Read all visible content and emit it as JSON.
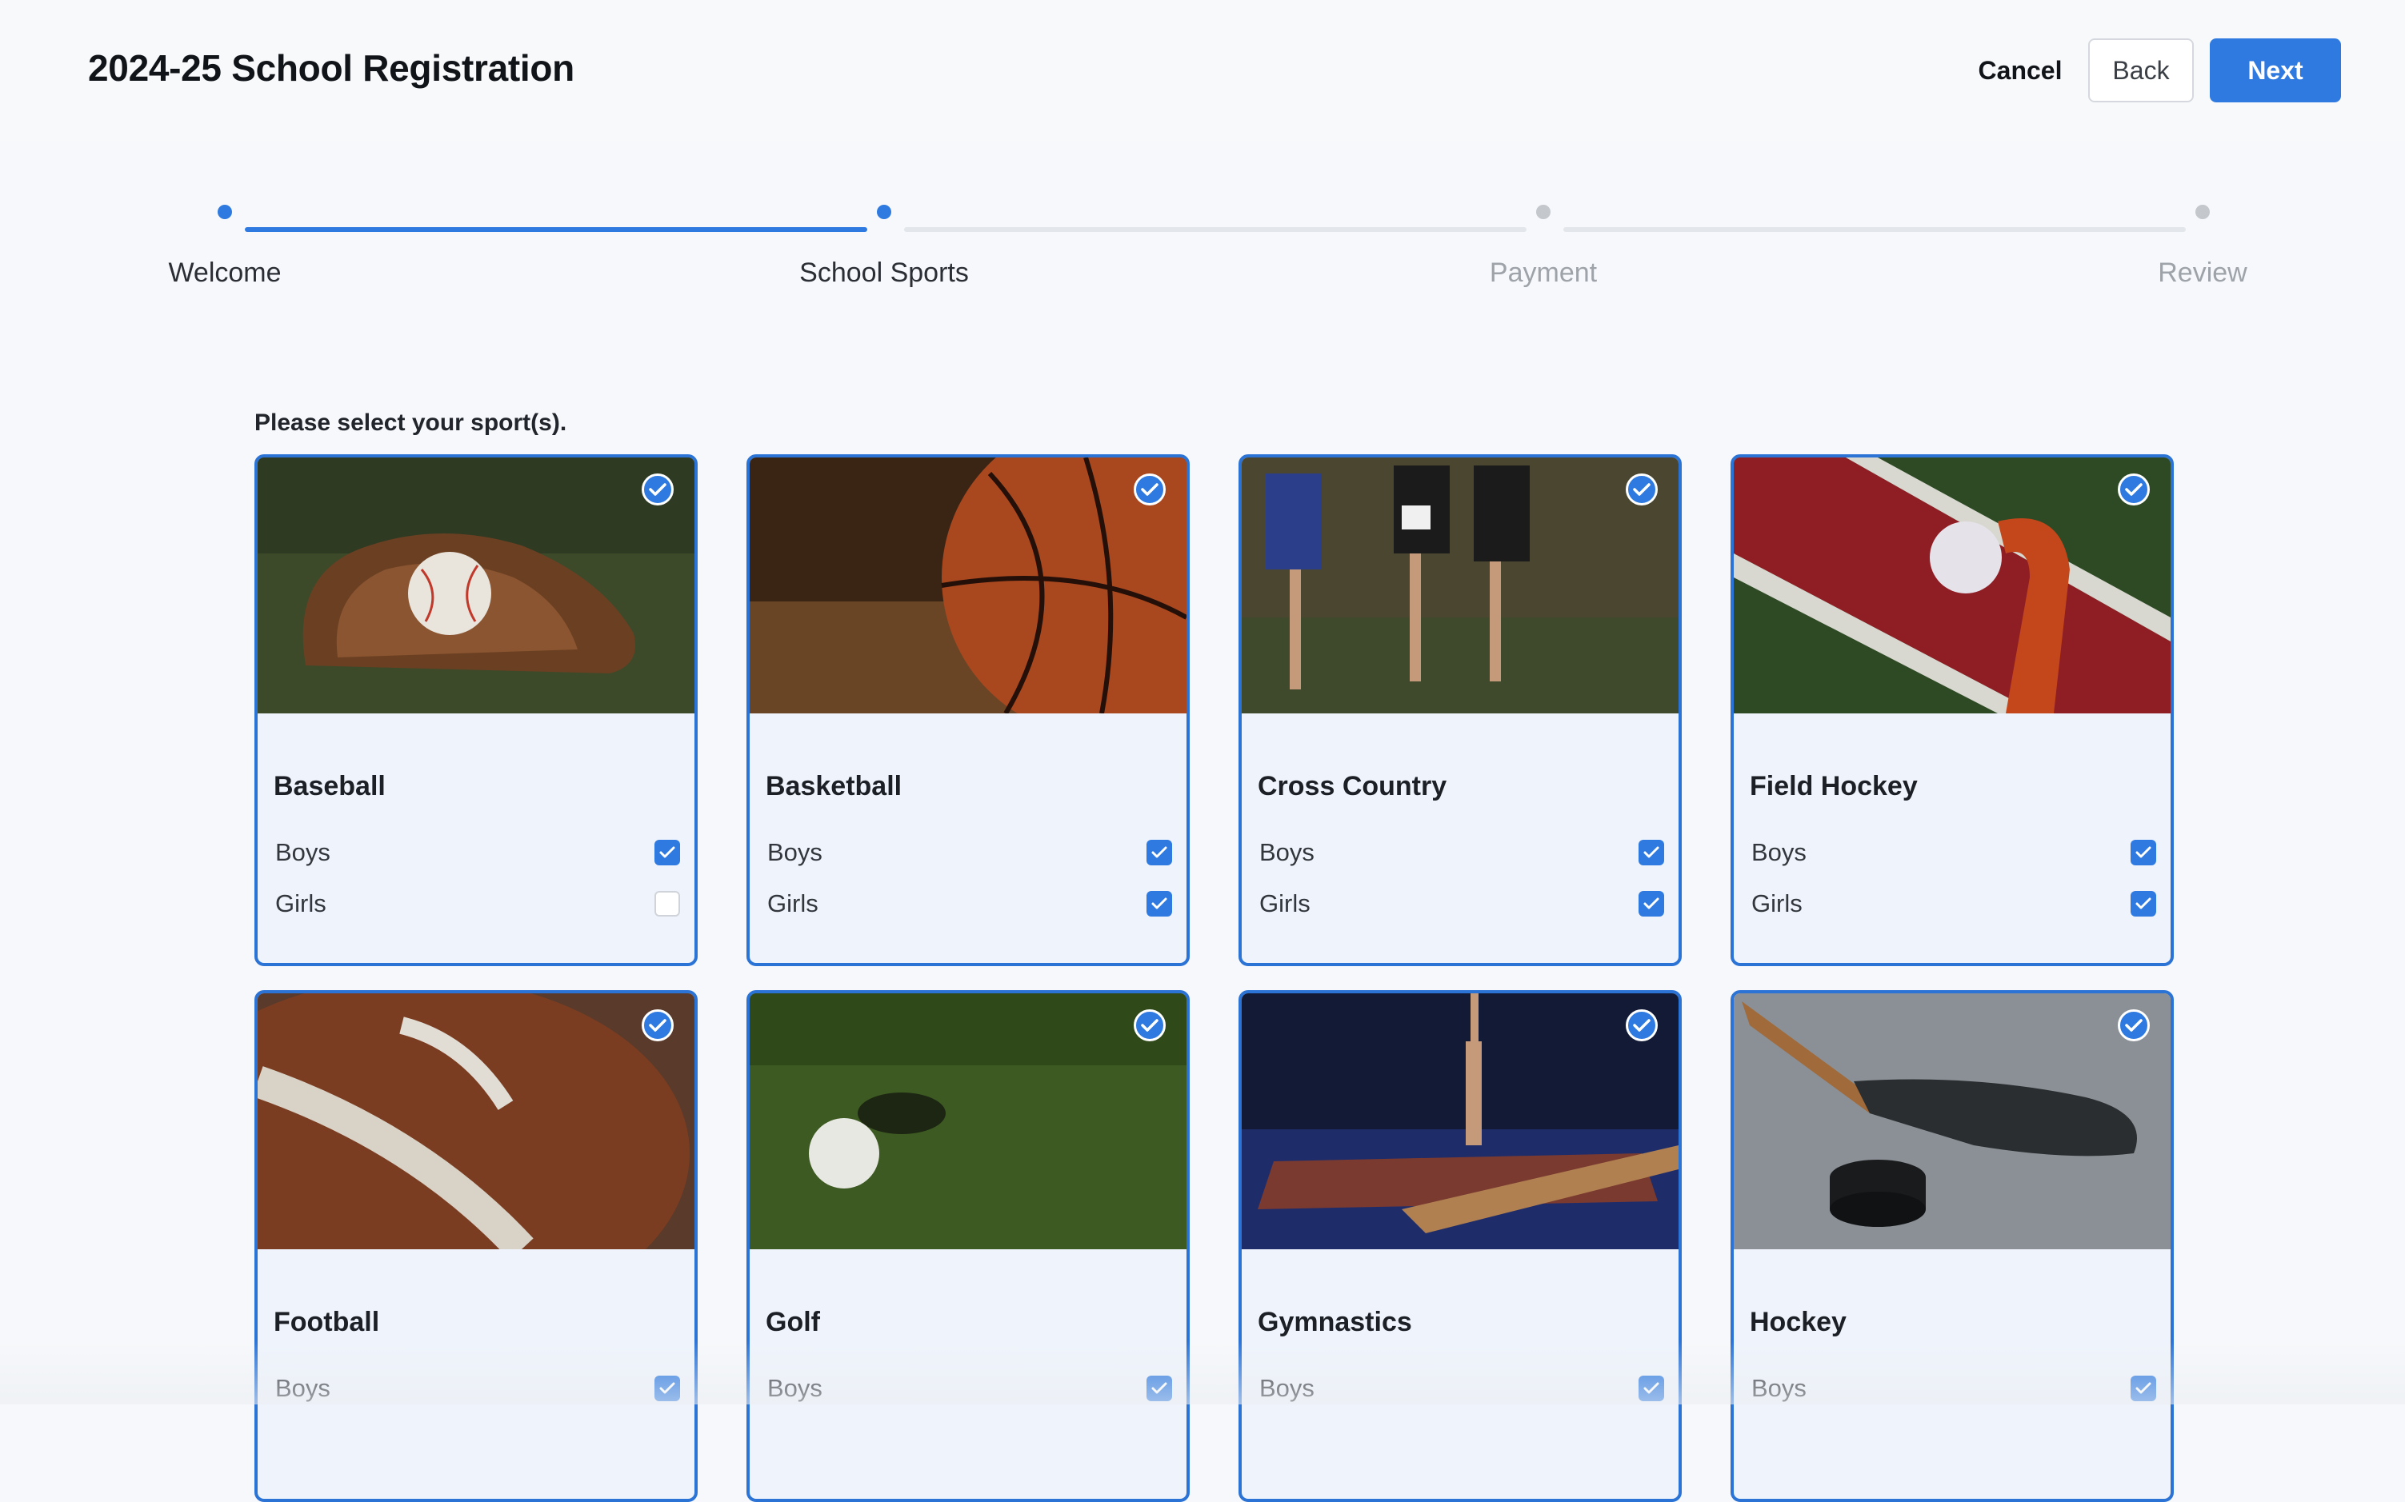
{
  "header": {
    "title": "2024-25 School Registration",
    "cancel_label": "Cancel",
    "back_label": "Back",
    "next_label": "Next"
  },
  "stepper": {
    "steps": [
      {
        "label": "Welcome",
        "state": "done"
      },
      {
        "label": "School Sports",
        "state": "current"
      },
      {
        "label": "Payment",
        "state": "upcoming"
      },
      {
        "label": "Review",
        "state": "upcoming"
      }
    ]
  },
  "main": {
    "prompt": "Please select your sport(s).",
    "sports": [
      {
        "name": "Baseball",
        "selected": true,
        "image_icon": "baseball-glove-photo",
        "options": [
          {
            "label": "Boys",
            "checked": true
          },
          {
            "label": "Girls",
            "checked": false
          }
        ]
      },
      {
        "name": "Basketball",
        "selected": true,
        "image_icon": "basketball-photo",
        "options": [
          {
            "label": "Boys",
            "checked": true
          },
          {
            "label": "Girls",
            "checked": true
          }
        ]
      },
      {
        "name": "Cross Country",
        "selected": true,
        "image_icon": "runners-photo",
        "options": [
          {
            "label": "Boys",
            "checked": true
          },
          {
            "label": "Girls",
            "checked": true
          }
        ]
      },
      {
        "name": "Field Hockey",
        "selected": true,
        "image_icon": "field-hockey-stick-photo",
        "options": [
          {
            "label": "Boys",
            "checked": true
          },
          {
            "label": "Girls",
            "checked": true
          }
        ]
      },
      {
        "name": "Football",
        "selected": true,
        "image_icon": "football-photo",
        "options": [
          {
            "label": "Boys",
            "checked": true
          }
        ]
      },
      {
        "name": "Golf",
        "selected": true,
        "image_icon": "golf-ball-photo",
        "options": [
          {
            "label": "Boys",
            "checked": true
          }
        ]
      },
      {
        "name": "Gymnastics",
        "selected": true,
        "image_icon": "gymnast-photo",
        "options": [
          {
            "label": "Boys",
            "checked": true
          }
        ]
      },
      {
        "name": "Hockey",
        "selected": true,
        "image_icon": "hockey-stick-puck-photo",
        "options": [
          {
            "label": "Boys",
            "checked": true
          }
        ]
      }
    ]
  },
  "colors": {
    "accent": "#2e7ae0",
    "card_border": "#2c73d6",
    "card_bg": "#eff4fc"
  }
}
